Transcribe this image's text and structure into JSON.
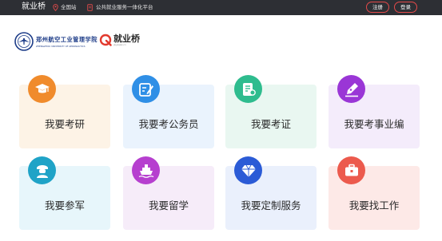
{
  "topbar": {
    "brand": "就业桥",
    "location": "全国站",
    "platform": "公共就业服务一体化平台",
    "register_label": "注册",
    "login_label": "登录"
  },
  "logos": {
    "school_cn": "郑州航空工业管理学院",
    "school_en": "ZHENGZHOU UNIVERSITY OF AERONAUTICS",
    "jyq_cn": "就业桥",
    "jyq_en": "jiuyeqiao.cn"
  },
  "services": [
    {
      "label": "我要考研",
      "icon": "graduation-cap-icon",
      "icon_color": "#f08b2c",
      "card_bg": "#fdf3e6"
    },
    {
      "label": "我要考公务员",
      "icon": "edit-pen-icon",
      "icon_color": "#2f8fe6",
      "card_bg": "#eaf3fd"
    },
    {
      "label": "我要考证",
      "icon": "certificate-icon",
      "icon_color": "#2ebc8e",
      "card_bg": "#e9f7f1"
    },
    {
      "label": "我要考事业编",
      "icon": "fountain-pen-icon",
      "icon_color": "#9a36d6",
      "card_bg": "#f4ecfb"
    },
    {
      "label": "我要参军",
      "icon": "soldier-icon",
      "icon_color": "#1fa3c7",
      "card_bg": "#e7f6fb"
    },
    {
      "label": "我要留学",
      "icon": "ship-icon",
      "icon_color": "#b63fcf",
      "card_bg": "#f6ecf9"
    },
    {
      "label": "我要定制服务",
      "icon": "diamond-icon",
      "icon_color": "#2b5bd6",
      "card_bg": "#eaf0fc"
    },
    {
      "label": "我要找工作",
      "icon": "briefcase-icon",
      "icon_color": "#ec5a4d",
      "card_bg": "#fde9e7"
    }
  ]
}
